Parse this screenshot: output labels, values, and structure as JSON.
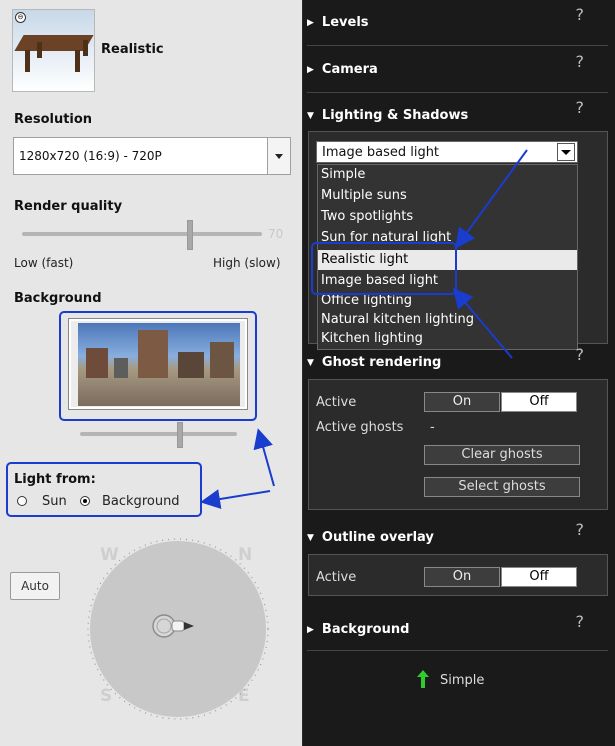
{
  "preset": {
    "name": "Realistic"
  },
  "resolution": {
    "label": "Resolution",
    "value": "1280x720 (16:9) - 720P"
  },
  "render_quality": {
    "label": "Render quality",
    "value": "70",
    "low_label": "Low (fast)",
    "high_label": "High (slow)"
  },
  "background": {
    "label": "Background"
  },
  "light_from": {
    "label": "Light from:",
    "options": [
      "Sun",
      "Background"
    ],
    "selected": "Background"
  },
  "auto_button": "Auto",
  "compass": {
    "letters": [
      "W",
      "N",
      "S",
      "E"
    ]
  },
  "sections": {
    "levels": "Levels",
    "camera": "Camera",
    "lighting": "Lighting & Shadows",
    "ghost": "Ghost rendering",
    "outline": "Outline overlay",
    "background": "Background",
    "help": "?"
  },
  "lighting": {
    "selected": "Image based light",
    "options": [
      "Simple",
      "Multiple suns",
      "Two spotlights",
      "Sun for natural light",
      "Realistic light",
      "Image based light",
      "Office lighting",
      "Natural kitchen lighting",
      "Kitchen lighting"
    ],
    "highlighted": "Realistic light"
  },
  "ghost": {
    "active_label": "Active",
    "on": "On",
    "off": "Off",
    "active_ghosts_label": "Active ghosts",
    "active_ghosts_value": "-",
    "clear": "Clear ghosts",
    "select": "Select ghosts"
  },
  "outline": {
    "active_label": "Active",
    "on": "On",
    "off": "Off"
  },
  "footer": {
    "preset": "Simple"
  },
  "colors": {
    "annotation": "#1a3ccf",
    "panel_dark": "#1a1a1a",
    "panel_light": "#e6e6e6",
    "arrow_green": "#2ecc2e"
  }
}
